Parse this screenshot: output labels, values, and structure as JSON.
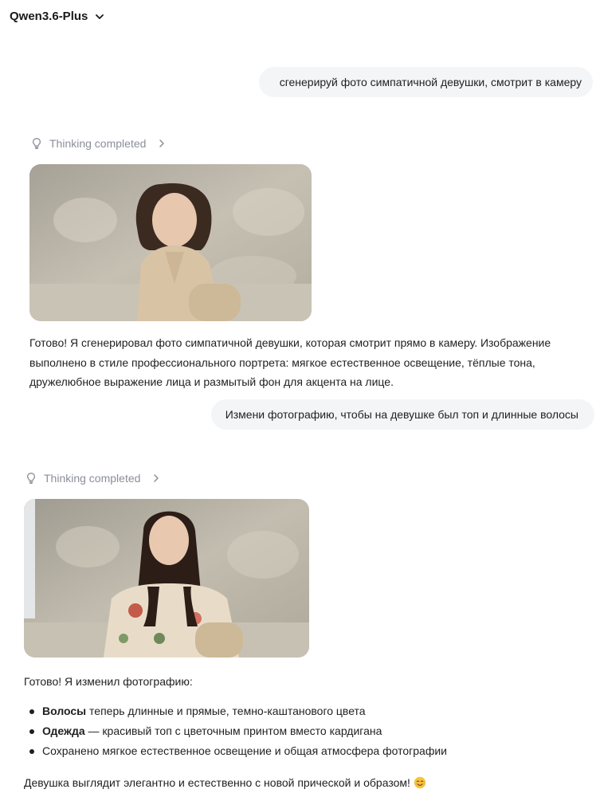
{
  "header": {
    "model_name": "Qwen3.6-Plus",
    "dropdown_icon": "chevron-down-icon"
  },
  "conversation": [
    {
      "role": "user",
      "text": "сгенерируй фото симпатичной девушки, смотрит в камеру"
    },
    {
      "role": "assistant",
      "thinking_label": "Thinking completed",
      "image": "woman-in-beige-cardigan-photo",
      "text": "Готово! Я сгенерировал фото симпатичной девушки, которая смотрит прямо в камеру. Изображение выполнено в стиле профессионального портрета: мягкое естественное освещение, тёплые тона, дружелюбное выражение лица и размытый фон для акцента на лице."
    },
    {
      "role": "user",
      "text": "Измени фотографию, чтобы на девушке был топ и длинные волосы"
    },
    {
      "role": "assistant",
      "thinking_label": "Thinking completed",
      "image": "woman-in-floral-top-photo",
      "intro": "Готово! Я изменил фотографию:",
      "bullets": [
        {
          "bold": "Волосы",
          "rest": " теперь длинные и прямые, темно-каштанового цвета"
        },
        {
          "bold": "Одежда",
          "rest": " — красивый топ с цветочным принтом вместо кардигана"
        },
        {
          "bold": "",
          "rest": "Сохранено мягкое естественное освещение и общая атмосфера фотографии"
        }
      ],
      "closing": "Девушка выглядит элегантно и естественно с новой прической и образом!",
      "closing_emoji": "smiling-face-emoji"
    }
  ],
  "colors": {
    "user_bubble_bg": "#f4f5f7",
    "muted_text": "#8a8f99",
    "text": "#1f1f1f"
  }
}
